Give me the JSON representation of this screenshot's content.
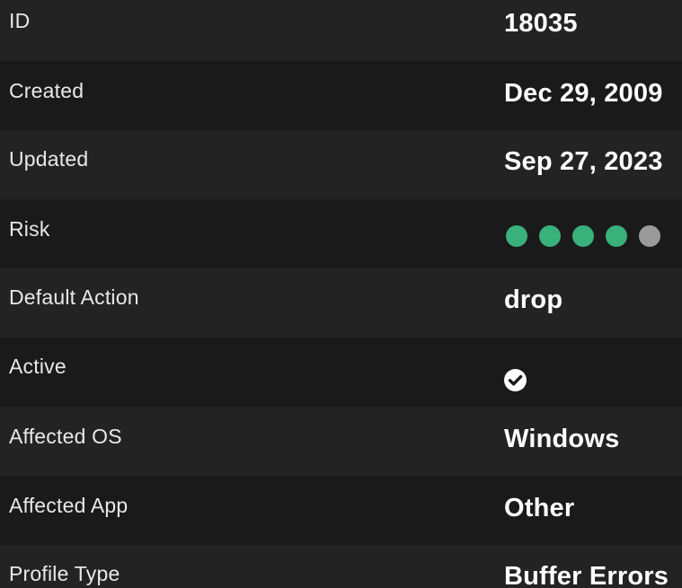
{
  "details": [
    {
      "label": "ID",
      "value": "18035"
    },
    {
      "label": "Created",
      "value": "Dec 29, 2009"
    },
    {
      "label": "Updated",
      "value": "Sep 27, 2023"
    },
    {
      "label": "Risk",
      "risk_level": 4,
      "risk_max": 5
    },
    {
      "label": "Default Action",
      "value": "drop"
    },
    {
      "label": "Active",
      "icon": "check-circle-icon",
      "checked": true
    },
    {
      "label": "Affected OS",
      "value": "Windows"
    },
    {
      "label": "Affected App",
      "value": "Other"
    },
    {
      "label": "Profile Type",
      "value": "Buffer Errors"
    }
  ],
  "colors": {
    "row_odd": "#232323",
    "row_even": "#1a1a1a",
    "risk_active": "#3ab07a",
    "risk_inactive": "#9a9a9a",
    "text": "#ffffff"
  }
}
